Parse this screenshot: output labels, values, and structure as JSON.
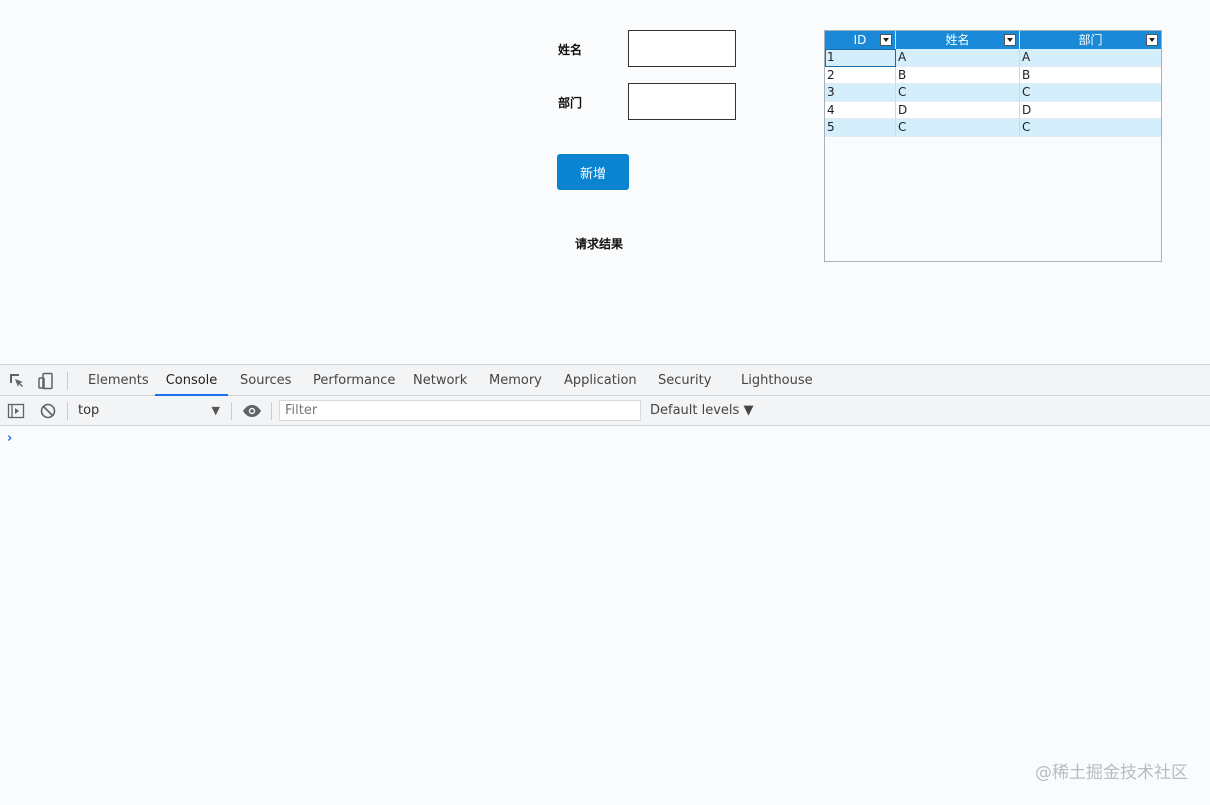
{
  "form": {
    "name_label": "姓名",
    "dept_label": "部门",
    "name_value": "",
    "dept_value": "",
    "add_button": "新增",
    "result_label": "请求结果"
  },
  "grid": {
    "columns": [
      "ID",
      "姓名",
      "部门"
    ],
    "rows": [
      [
        "1",
        "A",
        "A"
      ],
      [
        "2",
        "B",
        "B"
      ],
      [
        "3",
        "C",
        "C"
      ],
      [
        "4",
        "D",
        "D"
      ],
      [
        "5",
        "C",
        "C"
      ]
    ]
  },
  "devtools": {
    "tabs": [
      "Elements",
      "Console",
      "Sources",
      "Performance",
      "Network",
      "Memory",
      "Application",
      "Security",
      "Lighthouse"
    ],
    "active_tab": "Console",
    "context": "top",
    "filter_placeholder": "Filter",
    "levels": "Default levels ▼",
    "prompt": "›",
    "accent_color": "#1a73e8"
  },
  "watermark": "@稀土掘金技术社区",
  "colors": {
    "button": "#0a84d0",
    "grid_header": "#1a8ad8",
    "grid_row_alt": "#d4eefb"
  }
}
